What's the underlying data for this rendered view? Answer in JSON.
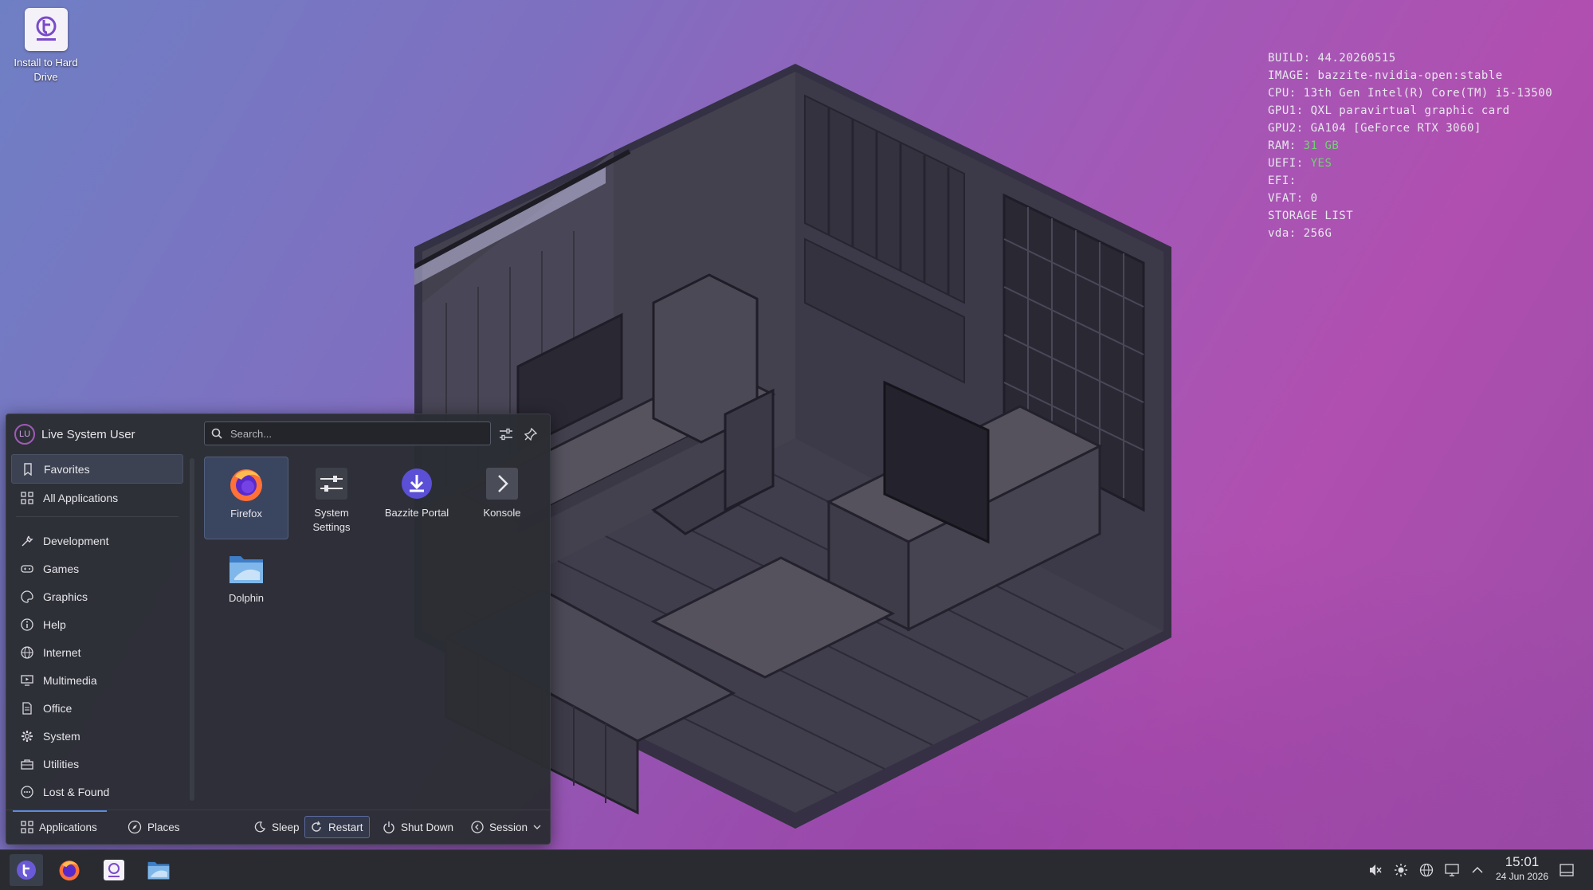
{
  "desktop": {
    "icon_label": "Install to Hard Drive"
  },
  "system_info": {
    "lines": [
      {
        "label": "BUILD:",
        "value": "44.20260515"
      },
      {
        "label": "IMAGE:",
        "value": "bazzite-nvidia-open:stable"
      },
      {
        "label": "CPU:",
        "value": "13th Gen Intel(R) Core(TM) i5-13500"
      },
      {
        "label": "GPU1:",
        "value": "QXL paravirtual graphic card"
      },
      {
        "label": "GPU2:",
        "value": "GA104 [GeForce RTX 3060]"
      },
      {
        "label": "RAM:",
        "value": "31 GB"
      },
      {
        "label": "UEFI:",
        "value": "YES"
      },
      {
        "label": "EFI:",
        "value": ""
      },
      {
        "label": "VFAT:",
        "value": "0"
      },
      {
        "label": "STORAGE LIST",
        "value": ""
      },
      {
        "label": "vda:",
        "value": "256G"
      }
    ],
    "highlight_color": "#6fd46f"
  },
  "menu": {
    "avatar_initials": "LU",
    "user_name": "Live System User",
    "search_placeholder": "Search...",
    "categories": [
      {
        "label": "Favorites",
        "icon": "bookmark-icon"
      },
      {
        "label": "All Applications",
        "icon": "grid-icon"
      },
      {
        "label": "Development",
        "icon": "wrench-icon"
      },
      {
        "label": "Games",
        "icon": "gamepad-icon"
      },
      {
        "label": "Graphics",
        "icon": "palette-icon"
      },
      {
        "label": "Help",
        "icon": "info-icon"
      },
      {
        "label": "Internet",
        "icon": "globe-icon"
      },
      {
        "label": "Multimedia",
        "icon": "monitor-play-icon"
      },
      {
        "label": "Office",
        "icon": "document-icon"
      },
      {
        "label": "System",
        "icon": "gear-icon"
      },
      {
        "label": "Utilities",
        "icon": "toolbox-icon"
      },
      {
        "label": "Lost & Found",
        "icon": "dots-icon"
      }
    ],
    "apps": [
      {
        "name": "Firefox"
      },
      {
        "name": "System Settings"
      },
      {
        "name": "Bazzite Portal"
      },
      {
        "name": "Konsole"
      },
      {
        "name": "Dolphin"
      }
    ],
    "footer": {
      "applications": "Applications",
      "places": "Places",
      "sleep": "Sleep",
      "restart": "Restart",
      "shutdown": "Shut Down",
      "session": "Session"
    }
  },
  "taskbar": {
    "time": "15:01",
    "date": "24 Jun 2026"
  },
  "colors": {
    "accent": "#a05ab8",
    "selection": "#3a4560",
    "taskbar": "#292b31"
  }
}
